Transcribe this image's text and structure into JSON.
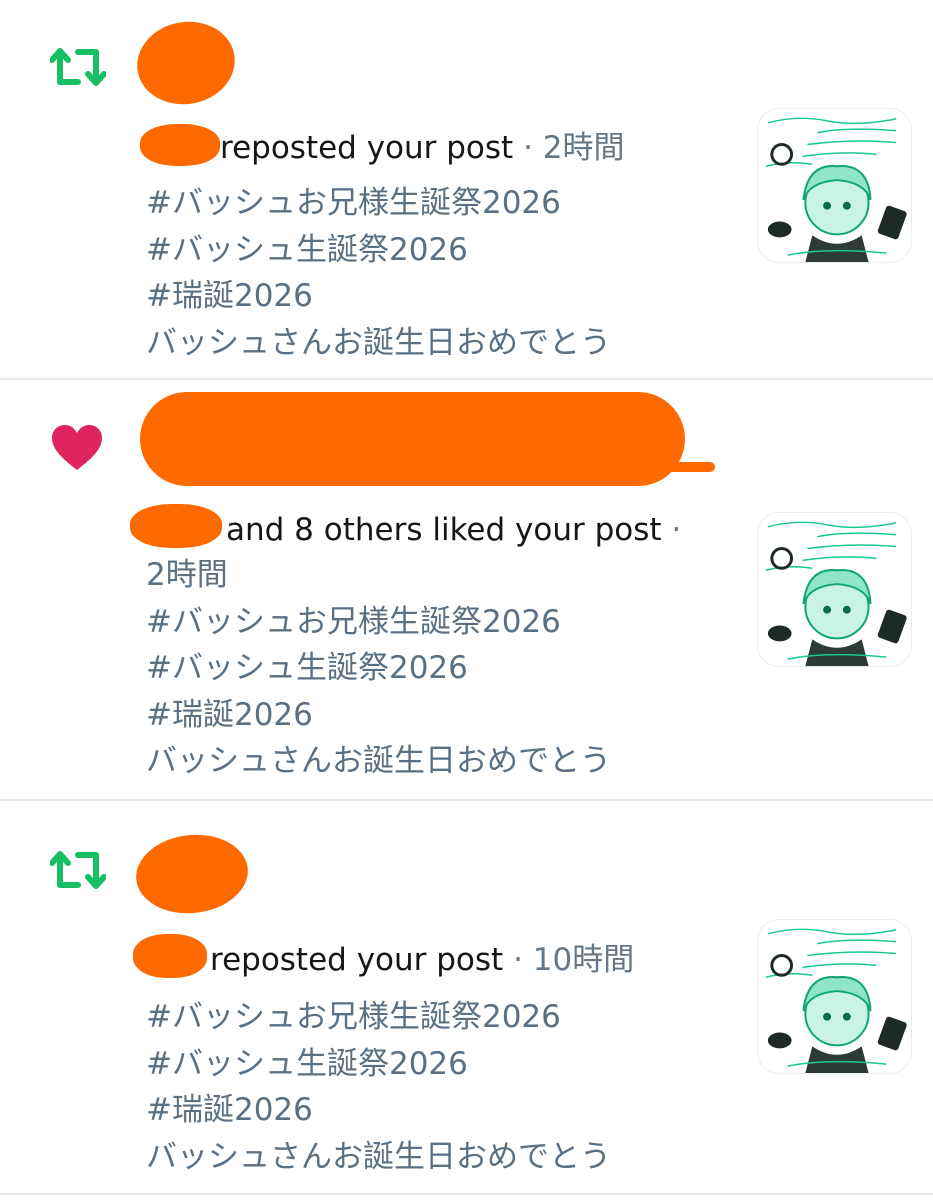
{
  "colors": {
    "repost_green": "#17bf63",
    "like_pink": "#e0245e",
    "redaction_orange": "#ff6a00",
    "secondary_text": "#5b7083",
    "primary_text": "#14171a",
    "divider": "#e6e9ec"
  },
  "notifications": [
    {
      "type": "repost",
      "icon": "repost-icon",
      "action": "reposted your post",
      "separator": "·",
      "time": "2時間",
      "body": [
        "#バッシュお兄様生誕祭2026",
        "#バッシュ生誕祭2026",
        "#瑞誕2026",
        "バッシュさんお誕生日おめでとう"
      ],
      "thumbnail_icon": "anime-birthday-artwork"
    },
    {
      "type": "like",
      "icon": "heart-icon",
      "action": "and 8 others liked your post",
      "separator": "·",
      "time": "2時間",
      "body": [
        "#バッシュお兄様生誕祭2026",
        "#バッシュ生誕祭2026",
        "#瑞誕2026",
        "バッシュさんお誕生日おめでとう"
      ],
      "thumbnail_icon": "anime-birthday-artwork"
    },
    {
      "type": "repost",
      "icon": "repost-icon",
      "action": "reposted your post",
      "separator": "·",
      "time": "10時間",
      "body": [
        "#バッシュお兄様生誕祭2026",
        "#バッシュ生誕祭2026",
        "#瑞誕2026",
        "バッシュさんお誕生日おめでとう"
      ],
      "thumbnail_icon": "anime-birthday-artwork"
    }
  ]
}
